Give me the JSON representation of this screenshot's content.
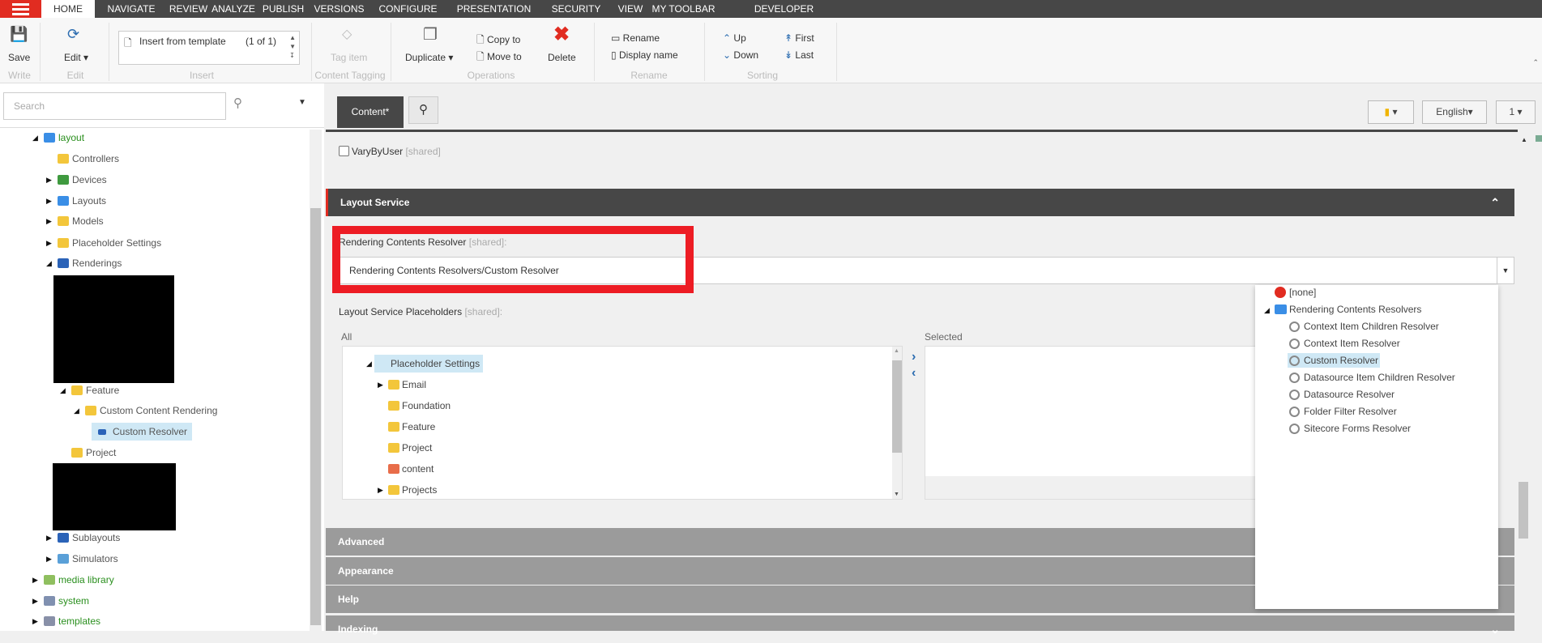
{
  "menu": [
    "HOME",
    "NAVIGATE",
    "REVIEW",
    "ANALYZE",
    "PUBLISH",
    "VERSIONS",
    "CONFIGURE",
    "PRESENTATION",
    "SECURITY",
    "VIEW",
    "MY TOOLBAR",
    "DEVELOPER"
  ],
  "ribbon": {
    "save": "Save",
    "edit": "Edit",
    "insert_item": "Insert from template",
    "insert_count": "(1 of 1)",
    "tag_item": "Tag item",
    "duplicate": "Duplicate",
    "copy_to": "Copy to",
    "move_to": "Move to",
    "delete": "Delete",
    "rename": "Rename",
    "display_name": "Display name",
    "up": "Up",
    "down": "Down",
    "first": "First",
    "last": "Last",
    "groups": {
      "write": "Write",
      "edit": "Edit",
      "insert": "Insert",
      "tagging": "Content Tagging",
      "operations": "Operations",
      "rename": "Rename",
      "sorting": "Sorting"
    }
  },
  "search": {
    "placeholder": "Search"
  },
  "tree": [
    {
      "label": "layout",
      "green": true,
      "toggle": "open",
      "icon": "layout-icon"
    },
    {
      "label": "Controllers",
      "icon": "folder-icon"
    },
    {
      "label": "Devices",
      "toggle": "closed",
      "icon": "device-icon"
    },
    {
      "label": "Layouts",
      "toggle": "closed",
      "icon": "layout-icon"
    },
    {
      "label": "Models",
      "toggle": "closed",
      "icon": "folder-icon"
    },
    {
      "label": "Placeholder Settings",
      "toggle": "closed",
      "icon": "folder-icon"
    },
    {
      "label": "Renderings",
      "toggle": "open",
      "icon": "renderings-icon"
    },
    {
      "label": "Feature",
      "toggle": "open",
      "icon": "feature-folder-icon"
    },
    {
      "label": "Custom Content Rendering",
      "toggle": "open",
      "icon": "folder-icon"
    },
    {
      "label": "Custom Resolver",
      "icon": "rendering-icon",
      "selected": true
    },
    {
      "label": "Project",
      "icon": "project-folder-icon"
    },
    {
      "label": "Sublayouts",
      "toggle": "closed",
      "icon": "sublayout-icon"
    },
    {
      "label": "Simulators",
      "toggle": "closed",
      "icon": "simulator-folder-icon"
    },
    {
      "label": "media library",
      "green": true,
      "toggle": "closed",
      "icon": "media-icon"
    },
    {
      "label": "system",
      "green": true,
      "toggle": "closed",
      "icon": "system-icon"
    },
    {
      "label": "templates",
      "green": true,
      "toggle": "closed",
      "icon": "templates-icon"
    }
  ],
  "tabs": {
    "content": "Content*"
  },
  "toolbar_right": {
    "language": "English",
    "version": "1"
  },
  "fields": {
    "vary_by_user": "VaryByUser",
    "shared": "[shared]",
    "section": "Layout Service",
    "resolver_label": "Rendering Contents Resolver",
    "resolver_shared": "[shared]:",
    "resolver_value": "Rendering Contents Resolvers/Custom Resolver",
    "placeholders_label": "Layout Service Placeholders",
    "placeholders_shared": "[shared]:",
    "all": "All",
    "selected": "Selected"
  },
  "all_list": [
    {
      "label": "Placeholder Settings",
      "toggle": "open",
      "selected": true
    },
    {
      "label": "Email",
      "toggle": "closed"
    },
    {
      "label": "Foundation"
    },
    {
      "label": "Feature"
    },
    {
      "label": "Project"
    },
    {
      "label": "content"
    },
    {
      "label": "Projects",
      "toggle": "closed"
    }
  ],
  "dropdown": {
    "none": "[none]",
    "folder": "Rendering Contents Resolvers",
    "items": [
      "Context Item Children Resolver",
      "Context Item Resolver",
      "Custom Resolver",
      "Datasource Item Children Resolver",
      "Datasource Resolver",
      "Folder Filter Resolver",
      "Sitecore Forms Resolver"
    ],
    "selected": "Custom Resolver"
  },
  "sections": [
    "Advanced",
    "Appearance",
    "Help",
    "Indexing"
  ],
  "colors": {
    "accent": "#e12c21",
    "highlight_box": "#ed1c24",
    "dark": "#474747",
    "selection": "#cfe8f5",
    "link_green": "#2a8f1e"
  }
}
